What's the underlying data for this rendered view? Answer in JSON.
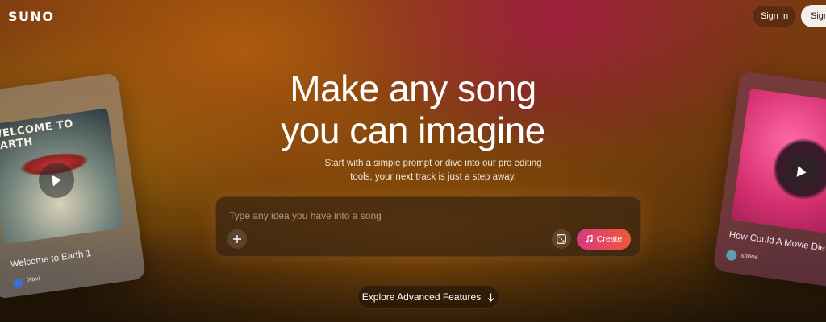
{
  "header": {
    "logo": "SUNO",
    "sign_in": "Sign In",
    "sign_up": "Sign"
  },
  "hero": {
    "headline_line1": "Make any song",
    "headline_line2": "you can imagine",
    "subtitle_line1": "Start with a simple prompt or dive into our pro editing",
    "subtitle_line2": "tools, your next track is just a step away."
  },
  "prompt": {
    "placeholder": "Type any idea you have into a song",
    "value": "",
    "add_icon": "plus-icon",
    "dice_icon": "dice-icon",
    "create_label": "Create",
    "create_icon": "music-note-icon"
  },
  "explore": {
    "label": "Explore Advanced Features",
    "icon": "arrow-down-icon"
  },
  "cards": {
    "left": {
      "art_text": "WELCOME TO EARTH",
      "title": "Welcome to Earth 1",
      "handle": "Xavi"
    },
    "right": {
      "title": "How Could A Movie Die?",
      "handle": "sonos"
    }
  },
  "colors": {
    "create_gradient_start": "#d63a7e",
    "create_gradient_end": "#ee5a3c",
    "signup_bg": "#f4efe8"
  }
}
